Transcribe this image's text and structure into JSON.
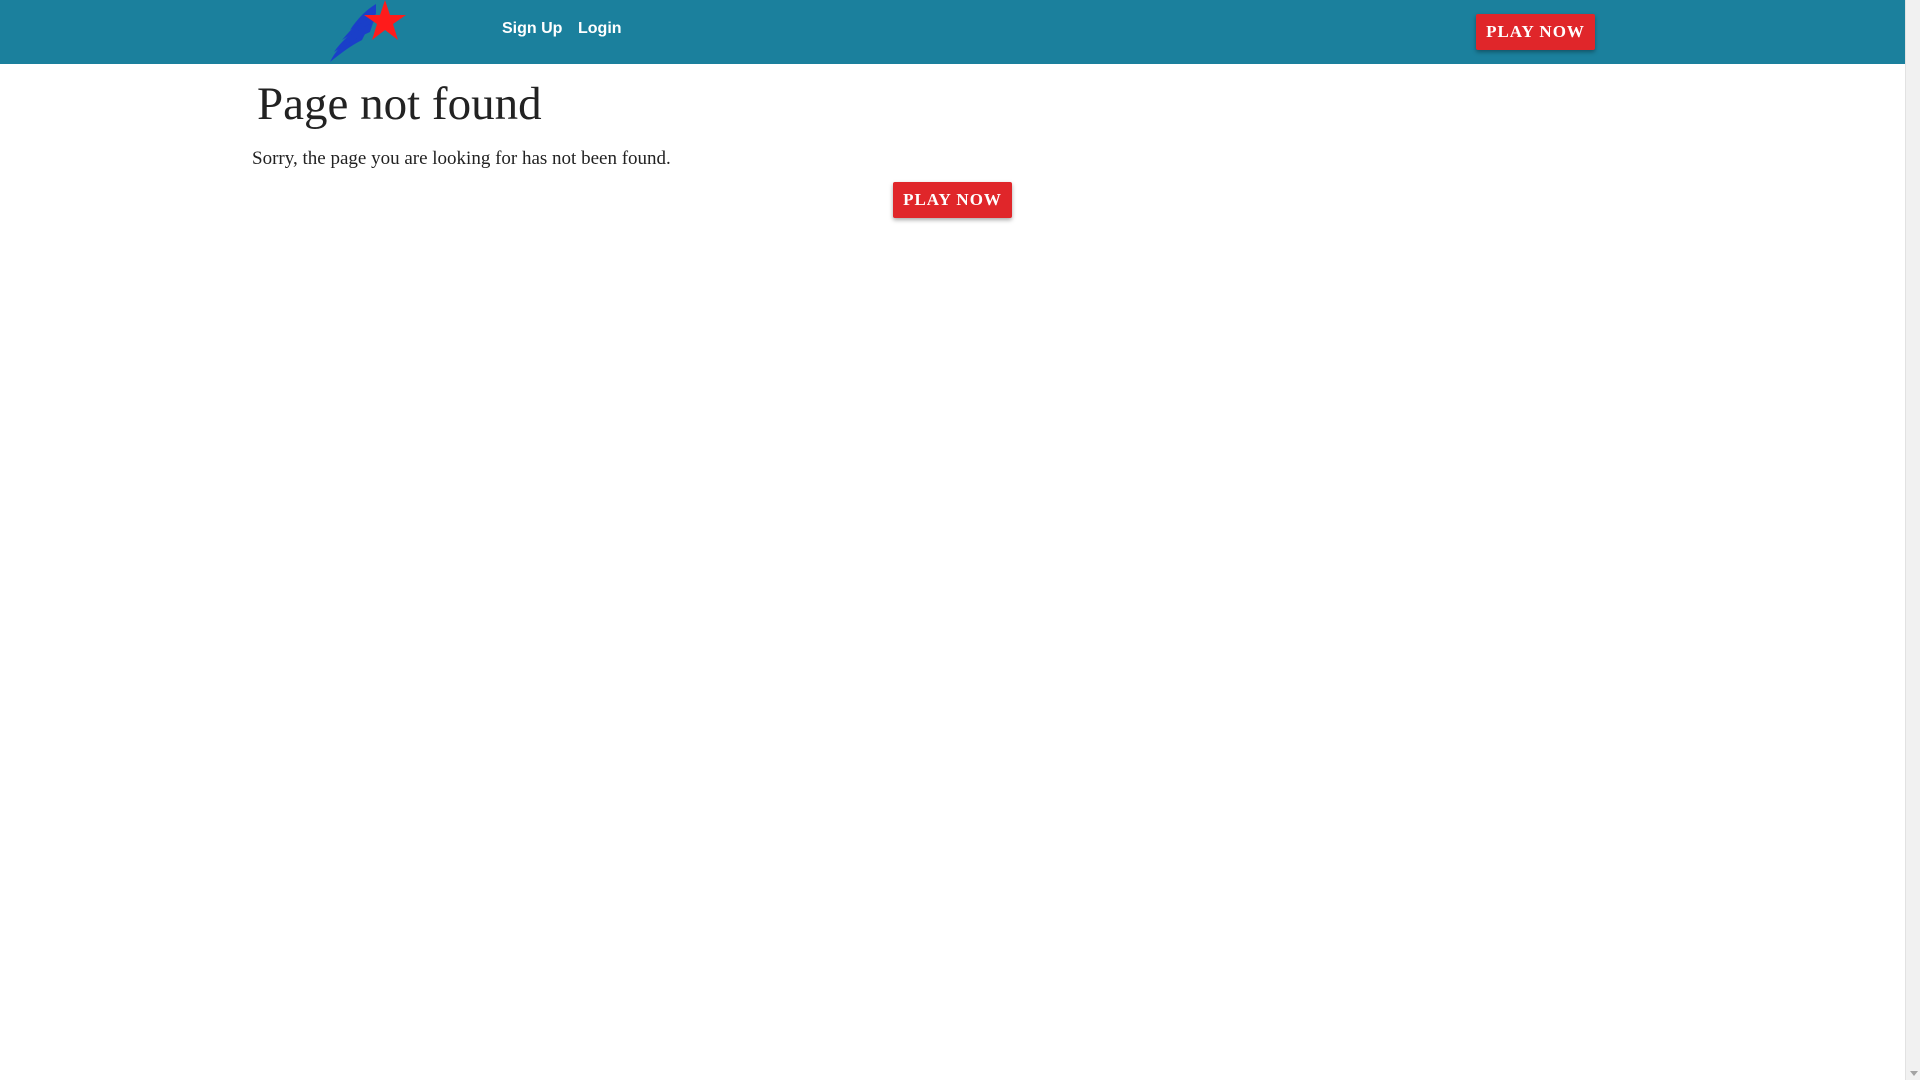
{
  "header": {
    "logo_icon": "shooting-star-logo-icon",
    "nav": {
      "signup_label": "Sign Up",
      "login_label": "Login"
    },
    "play_now_label": "PLAY NOW"
  },
  "main": {
    "title": "Page not found",
    "message": "Sorry, the page you are looking for has not been found.",
    "play_now_label": "PLAY NOW"
  },
  "colors": {
    "header_bg": "#1b809d",
    "button_bg": "#e0262a",
    "logo_star": "#ff1b1b",
    "logo_swoosh": "#1a3fc9",
    "text": "#222222"
  }
}
